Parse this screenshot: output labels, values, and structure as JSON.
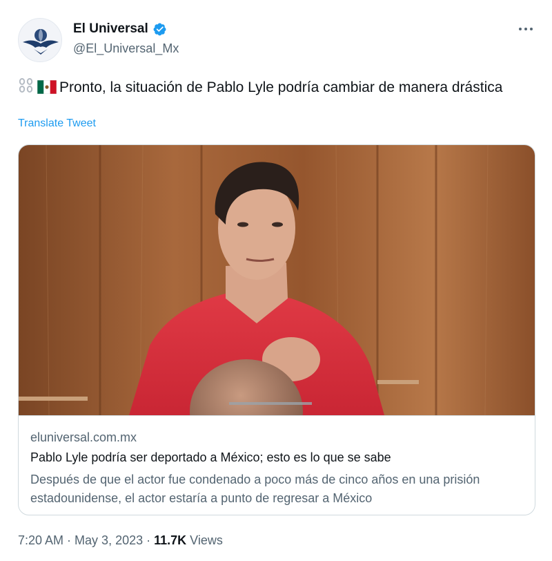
{
  "author": {
    "display_name": "El Universal",
    "handle": "@El_Universal_Mx",
    "verified": true,
    "verified_color": "#1d9bf0"
  },
  "icons": {
    "avatar": "eagle-logo-icon",
    "verified": "verified-badge-icon",
    "more": "more-options-icon",
    "emojis": [
      "chains-icon",
      "mexico-flag-icon"
    ]
  },
  "tweet": {
    "text": "Pronto, la situación de Pablo Lyle podría cambiar de manera drástica",
    "translate_label": "Translate Tweet"
  },
  "card": {
    "domain": "eluniversal.com.mx",
    "title": "Pablo Lyle podría ser deportado a México; esto es lo que se sabe",
    "description": "Después de que el actor fue condenado a poco más de cinco años en una prisión estadounidense, el actor estaría a punto de regresar a México"
  },
  "meta": {
    "time": "7:20 AM",
    "date": "May 3, 2023",
    "separator": "·",
    "views_count": "11.7K",
    "views_label": "Views"
  },
  "colors": {
    "link": "#1d9bf0",
    "secondary_text": "#536471",
    "primary_text": "#0f1419",
    "border": "#cfd9de"
  }
}
